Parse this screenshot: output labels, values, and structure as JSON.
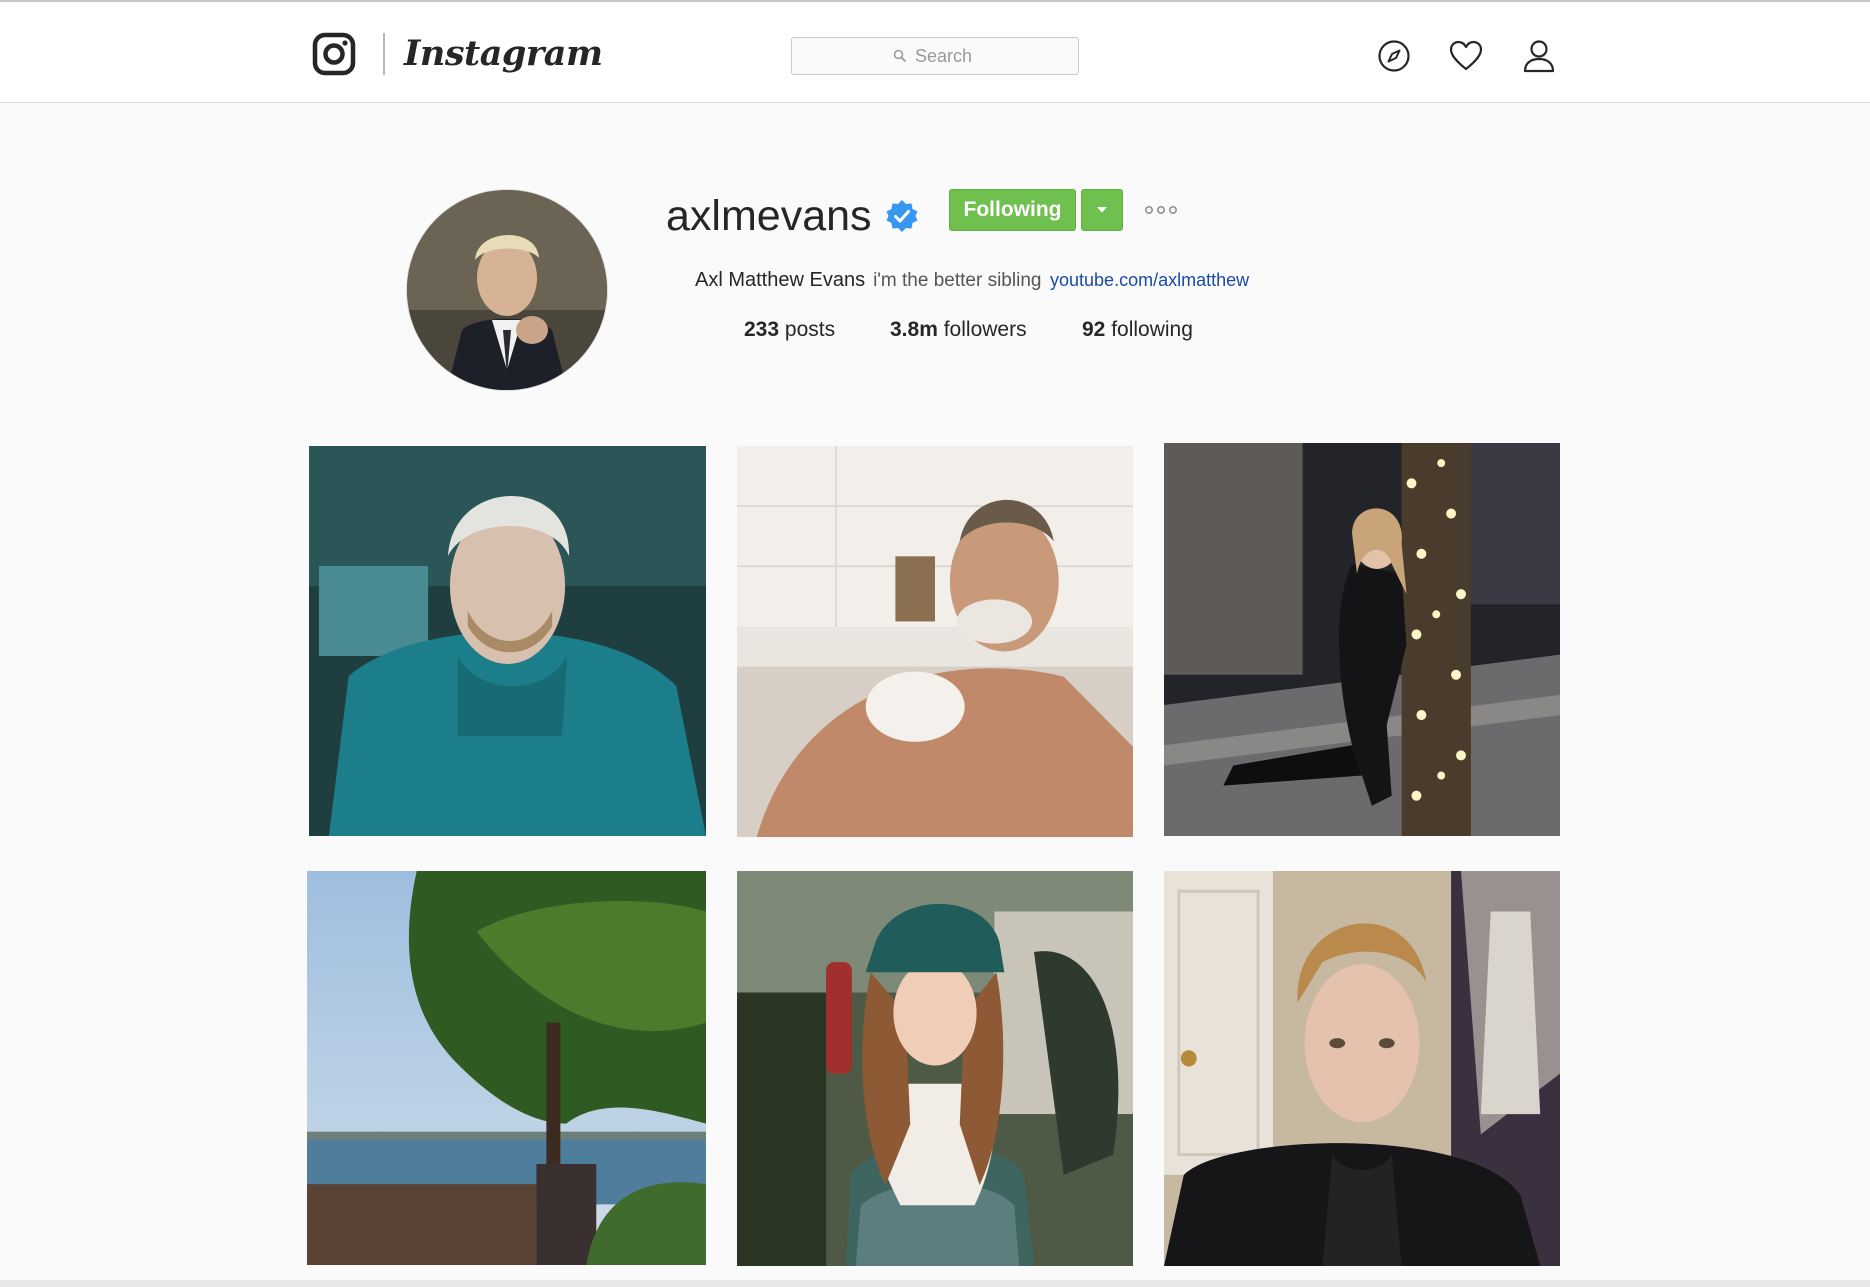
{
  "header": {
    "wordmark": "Instagram",
    "search_placeholder": "Search",
    "icons": [
      "instagram-glyph-icon",
      "compass-icon",
      "heart-icon",
      "person-icon"
    ]
  },
  "profile": {
    "username": "axlmevans",
    "verified": true,
    "follow_label": "Following",
    "full_name": "Axl Matthew Evans",
    "bio": "i'm the better sibling",
    "link": "youtube.com/axlmatthew",
    "stats": {
      "posts_count": "233",
      "posts_label": "posts",
      "followers_count": "3.8m",
      "followers_label": "followers",
      "following_count": "92",
      "following_label": "following"
    }
  },
  "colors": {
    "following_green": "#70c050",
    "verified_blue": "#3897f0",
    "link_blue": "#1a4aa6"
  }
}
